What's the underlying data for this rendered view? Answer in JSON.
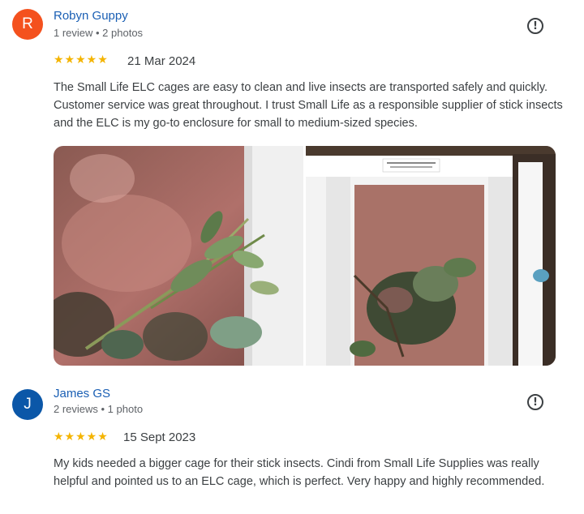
{
  "reviews": [
    {
      "avatar_letter": "R",
      "name": "Robyn Guppy",
      "meta": "1 review • 2 photos",
      "stars": "★★★★★",
      "date": "21 Mar 2024",
      "text": "The Small Life ELC cages are easy to clean and live insects are transported safely and quickly. Customer service was great throughout. I trust Small Life as a responsible supplier of stick insects and the ELC is my go-to enclosure for small to medium-sized species.",
      "flag_icon": "!"
    },
    {
      "avatar_letter": "J",
      "name": "James GS",
      "meta": "2 reviews • 1 photo",
      "stars": "★★★★★",
      "date": "15 Sept 2023",
      "text": "My kids needed a bigger cage for their stick insects. Cindi from Small Life Supplies was really helpful and pointed us to an ELC cage, which is perfect. Very happy and highly recommended.",
      "flag_icon": "!"
    }
  ],
  "photos": [
    {
      "icon": "photo-stick-insect-close-up"
    },
    {
      "icon": "photo-elc-cage",
      "label_text": "ELC cage. Made in Great Britain. Small Life Supplies 2018 www.small-life.co.uk"
    }
  ],
  "colors": {
    "avatar_r": "#f4511e",
    "avatar_j": "#0b57a8",
    "name_link": "#1a5fb4",
    "stars": "#f4b400"
  }
}
